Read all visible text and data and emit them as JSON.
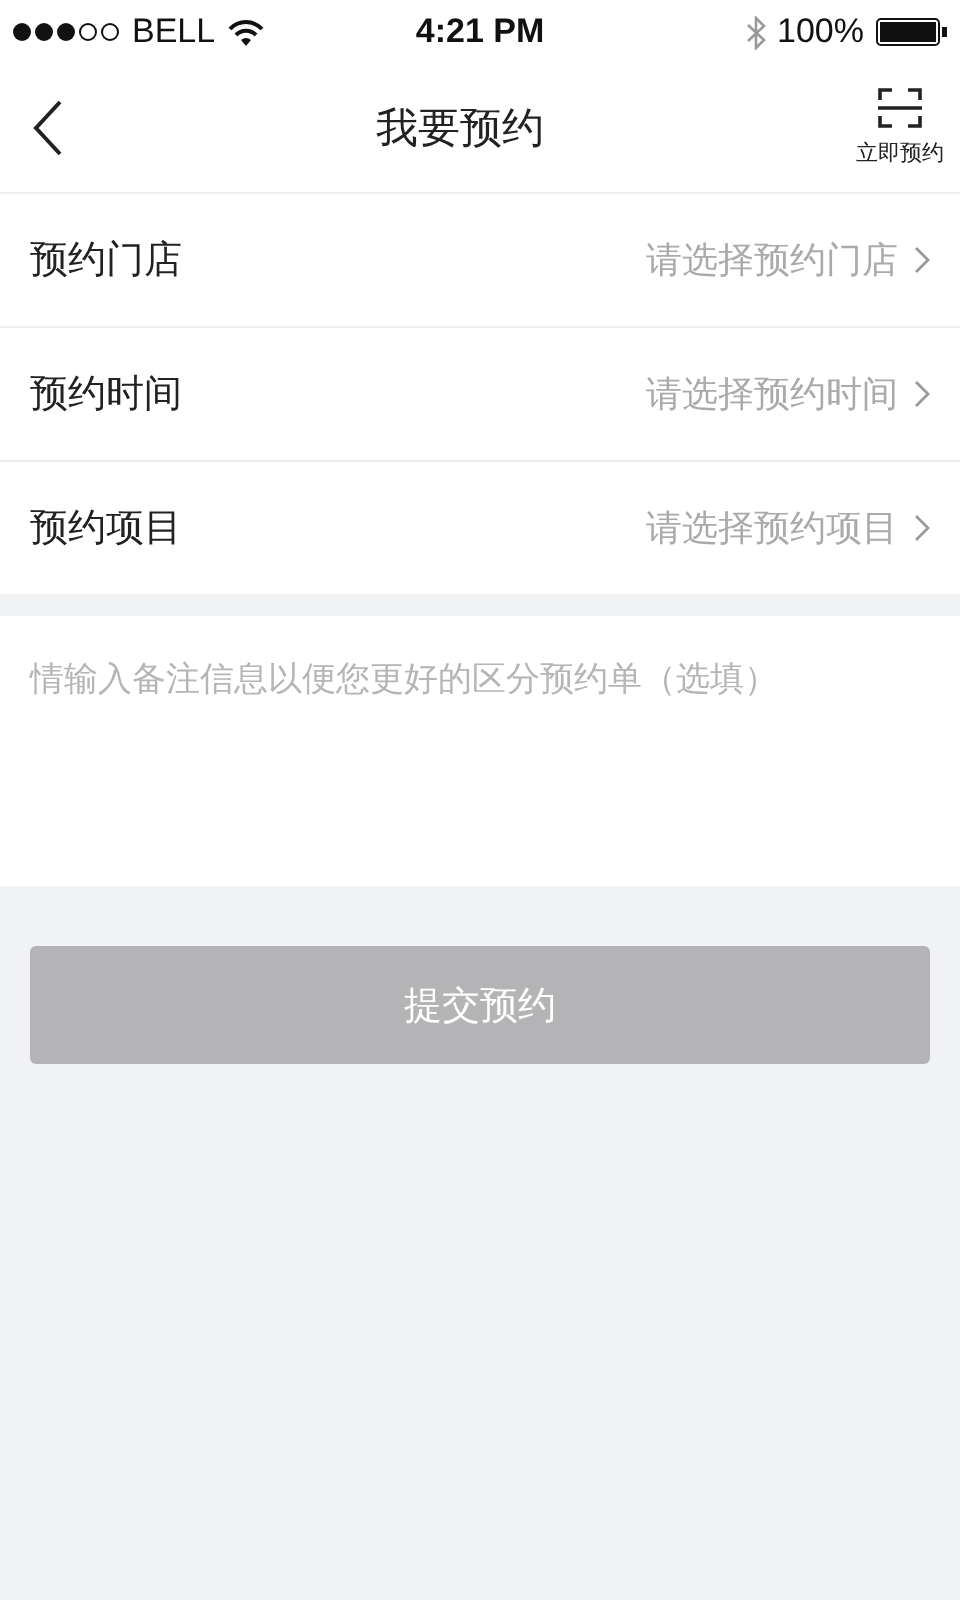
{
  "status_bar": {
    "carrier": "BELL",
    "time": "4:21 PM",
    "battery": "100%"
  },
  "nav": {
    "title": "我要预约",
    "action_label": "立即预约"
  },
  "fields": [
    {
      "label": "预约门店",
      "placeholder": "请选择预约门店"
    },
    {
      "label": "预约时间",
      "placeholder": "请选择预约时间"
    },
    {
      "label": "预约项目",
      "placeholder": "请选择预约项目"
    }
  ],
  "note": {
    "placeholder": "情输入备注信息以便您更好的区分预约单（选填）"
  },
  "submit": {
    "label": "提交预约",
    "disabled": true
  }
}
